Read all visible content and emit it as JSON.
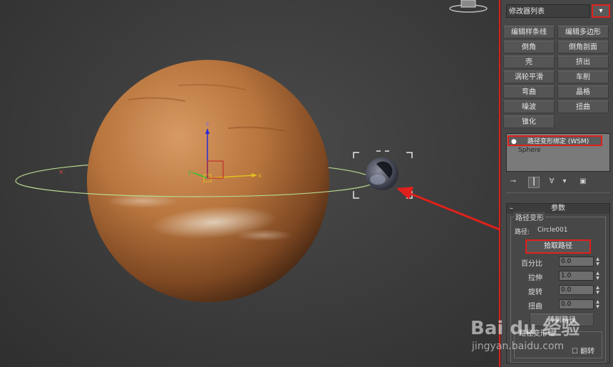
{
  "panel": {
    "modifier_list_label": "修改器列表",
    "dropdown_glyph": "▾",
    "buttons": [
      {
        "label": "编辑样条线"
      },
      {
        "label": "编辑多边形"
      },
      {
        "label": "倒角"
      },
      {
        "label": "倒角剖面"
      },
      {
        "label": "壳"
      },
      {
        "label": "挤出"
      },
      {
        "label": "涡轮平滑"
      },
      {
        "label": "车削"
      },
      {
        "label": "弯曲"
      },
      {
        "label": "晶格"
      },
      {
        "label": "噪波"
      },
      {
        "label": "扭曲"
      },
      {
        "label": "锥化"
      }
    ],
    "stack": {
      "selected": "路径变形绑定 (WSM)",
      "item": "Sphere"
    },
    "toolbar_icons": [
      "pin-stack-icon",
      "show-end-result-icon",
      "make-unique-icon",
      "remove-modifier-icon",
      "configure-sets-icon"
    ],
    "rollout": {
      "title": "参数",
      "collapse_glyph": "–",
      "group_title": "路径变形",
      "path_label": "路径:",
      "path_value": "Circle001",
      "pick_button": "拾取路径",
      "spinners": [
        {
          "label": "百分比",
          "value": "0.0"
        },
        {
          "label": "拉伸",
          "value": "1.0"
        },
        {
          "label": "旋转",
          "value": "0.0"
        },
        {
          "label": "扭曲",
          "value": "0.0"
        }
      ],
      "bottom_button": "转到路径",
      "bottom_group_title": "路径变形轴",
      "flip_label": "翻转"
    }
  },
  "viewport": {
    "axis_labels": {
      "x": "x",
      "y": "y",
      "z": "z"
    }
  },
  "watermark": {
    "brand": "Bai du 经验",
    "url": "jingyan.baidu.com"
  },
  "colors": {
    "accent_red": "#e0201c",
    "path_green": "#b8d890",
    "planet_orange": "#b06a38"
  }
}
